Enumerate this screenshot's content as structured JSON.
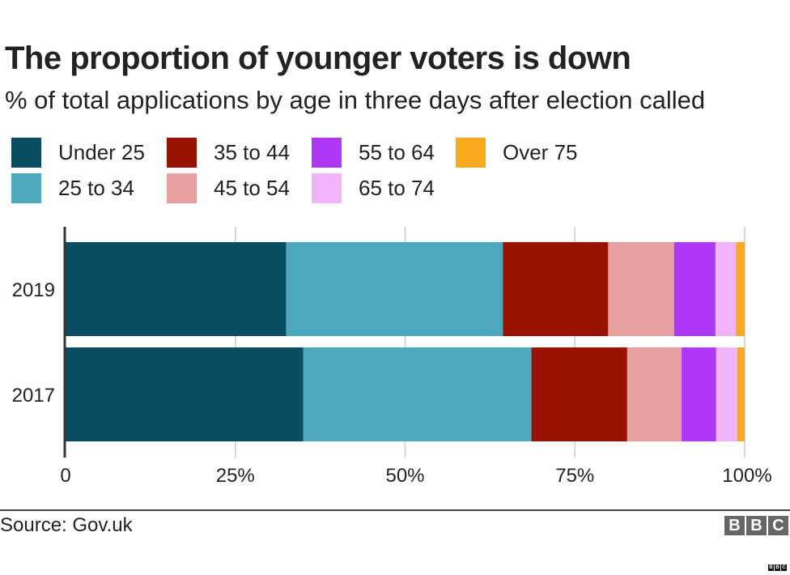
{
  "chart_data": {
    "type": "bar",
    "orientation": "horizontal-stacked",
    "title": "The proportion of younger voters is down",
    "subtitle": "% of total applications by age in three days after election called",
    "categories": [
      "2019",
      "2017"
    ],
    "series": [
      {
        "name": "Under 25",
        "color": "#0b4d60",
        "values": [
          32.5,
          35.0
        ]
      },
      {
        "name": "25 to 34",
        "color": "#4ba8bd",
        "values": [
          31.9,
          33.6
        ]
      },
      {
        "name": "35 to 44",
        "color": "#991200",
        "values": [
          15.5,
          14.1
        ]
      },
      {
        "name": "45 to 54",
        "color": "#e6a0a0",
        "values": [
          9.7,
          8.0
        ]
      },
      {
        "name": "55 to 64",
        "color": "#af37f7",
        "values": [
          6.1,
          5.1
        ]
      },
      {
        "name": "65 to 74",
        "color": "#f0b4fb",
        "values": [
          3.0,
          3.1
        ]
      },
      {
        "name": "Over 75",
        "color": "#f9a91c",
        "values": [
          1.3,
          1.1
        ]
      }
    ],
    "xlim": [
      0,
      100
    ],
    "xticks": [
      0,
      25,
      50,
      75,
      100
    ],
    "xtick_labels": [
      "0",
      "25%",
      "50%",
      "75%",
      "100%"
    ],
    "xlabel": "",
    "ylabel": "",
    "grid": true,
    "legend_position": "top"
  },
  "footer": {
    "source": "Source: Gov.uk",
    "logo_letters": [
      "B",
      "B",
      "C"
    ]
  }
}
